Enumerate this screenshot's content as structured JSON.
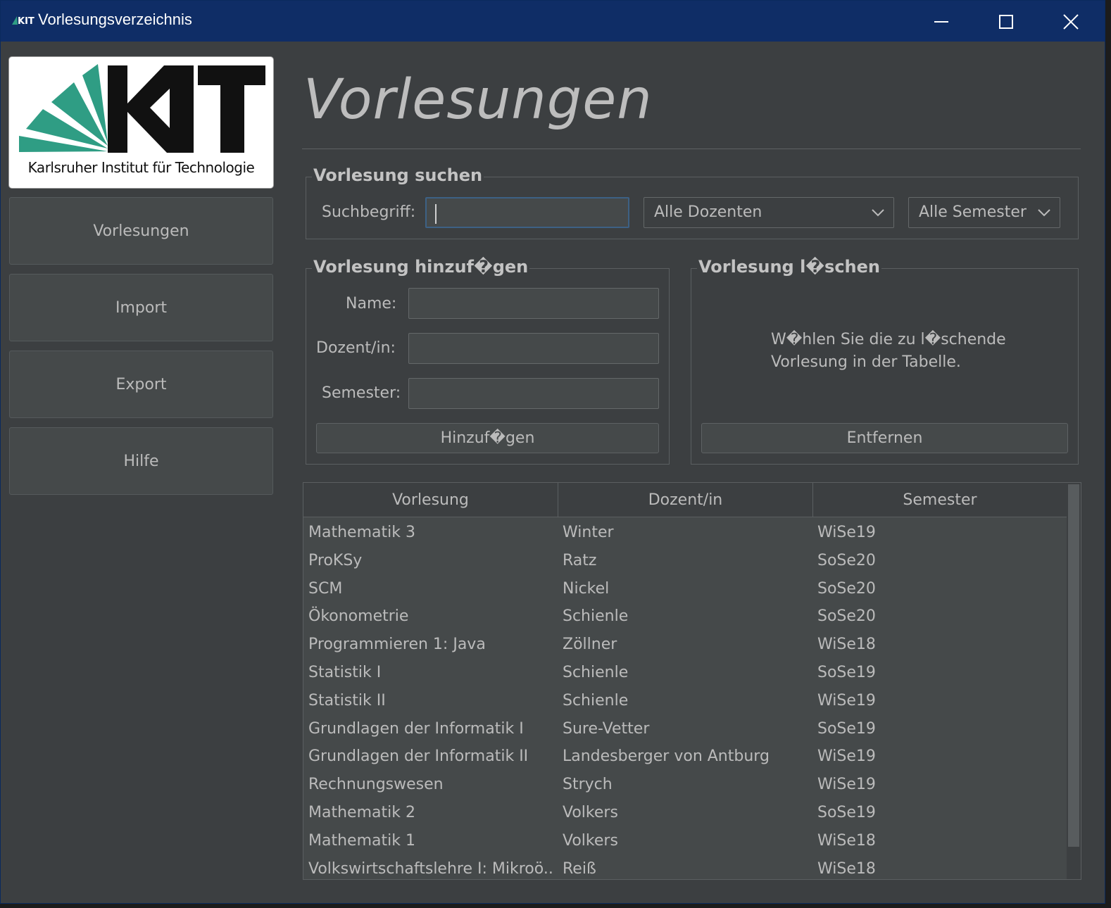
{
  "window": {
    "title": "Vorlesungsverzeichnis"
  },
  "logo": {
    "caption": "Karlsruher Institut für Technologie"
  },
  "nav": [
    {
      "label": "Vorlesungen"
    },
    {
      "label": "Import"
    },
    {
      "label": "Export"
    },
    {
      "label": "Hilfe"
    }
  ],
  "page": {
    "heading": "Vorlesungen"
  },
  "search": {
    "title": "Vorlesung suchen",
    "label": "Suchbegriff:",
    "value": "",
    "lecturer_filter": "Alle Dozenten",
    "semester_filter": "Alle Semester"
  },
  "add": {
    "title": "Vorlesung hinzuf�gen",
    "name_label": "Name:",
    "lecturer_label": "Dozent/in:",
    "semester_label": "Semester:",
    "button": "Hinzuf�gen"
  },
  "remove": {
    "title": "Vorlesung l�schen",
    "info_line1": "W�hlen Sie die zu l�schende",
    "info_line2": "Vorlesung in der Tabelle.",
    "button": "Entfernen"
  },
  "table": {
    "columns": [
      "Vorlesung",
      "Dozent/in",
      "Semester"
    ],
    "rows": [
      [
        "Mathematik 3",
        "Winter",
        "WiSe19"
      ],
      [
        "ProKSy",
        "Ratz",
        "SoSe20"
      ],
      [
        "SCM",
        "Nickel",
        "SoSe20"
      ],
      [
        "Ökonometrie",
        "Schienle",
        "SoSe20"
      ],
      [
        "Programmieren 1: Java",
        "Zöllner",
        "WiSe18"
      ],
      [
        "Statistik I",
        "Schienle",
        "SoSe19"
      ],
      [
        "Statistik II",
        "Schienle",
        "WiSe19"
      ],
      [
        "Grundlagen der Informatik I",
        "Sure-Vetter",
        "SoSe19"
      ],
      [
        "Grundlagen der Informatik II",
        "Landesberger von Antburg",
        "WiSe19"
      ],
      [
        "Rechnungswesen",
        "Strych",
        "WiSe19"
      ],
      [
        "Mathematik 2",
        "Volkers",
        "SoSe19"
      ],
      [
        "Mathematik 1",
        "Volkers",
        "WiSe18"
      ],
      [
        "Volkswirtschaftslehre I: Mikroö...",
        "Reiß",
        "WiSe18"
      ]
    ]
  },
  "colors": {
    "titlebar": "#0f2d66",
    "panel": "#3c3f41",
    "kit_green": "#2f9d84"
  }
}
